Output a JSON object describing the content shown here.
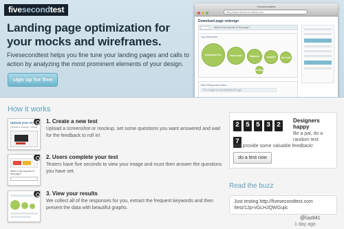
{
  "logo": {
    "bold": "five",
    "light": "second",
    "rest": "test"
  },
  "hero": {
    "title_line1": "Landing page optimization for",
    "title_line2": "your mocks and wireframes.",
    "description": "Fivesecondtest helps you fine tune your landing pages and calls to action by analyzing the most prominent elements of your design.",
    "signup_label": "sign up for free"
  },
  "mockup": {
    "window_title": "Fivesecondtest",
    "url": "http://www.fivesecondtest.com",
    "page_heading": "Download page redesign",
    "question": "What is the purpose of this page?",
    "panel_label": "Top Elements",
    "bubbles": [
      "download free",
      "learn more",
      "features",
      "support",
      "free trial",
      "pricing"
    ],
    "panel2_label": "New Response Data",
    "panel2_row": "\"It's a page for downloading the app\""
  },
  "how": {
    "title": "How it works",
    "steps": [
      {
        "title": "1. Create a new test",
        "desc": "Upload a screenshot or mockup, set some questions you want answered and wait for the feedback to roll in!",
        "thumb_text": "Upload your image",
        "thumb_sub": "Upload a mockup, simply"
      },
      {
        "title": "2. Users complete your test",
        "desc": "Testers have five seconds to view your image and must then answer the questions you have set.",
        "thumb_text": "What is the purpose of this page?"
      },
      {
        "title": "3. View your results",
        "desc": "We collect all of the responses for you, extract the frequent keywords and then present the data with beautiful graphs."
      }
    ]
  },
  "counter": {
    "digits": [
      "2",
      "5",
      "5",
      "3",
      "2",
      "7"
    ],
    "headline": "Designers happy",
    "subtext": "Be a pal, do a random test",
    "feedback": "and provide some valuable feedback!",
    "button_label": "do a test now"
  },
  "buzz": {
    "title": "Read the buzz",
    "tweet": "Just testing http://fivesecondtest.com /test/12p-vGLHJQWGujic",
    "author": "@caz841",
    "time": "1 day ago"
  },
  "colors": {
    "accent": "#5e9fbc",
    "hero_bg": "#cfe0e9",
    "button": "#7fbbd0",
    "bubble": "#a6c95c"
  }
}
